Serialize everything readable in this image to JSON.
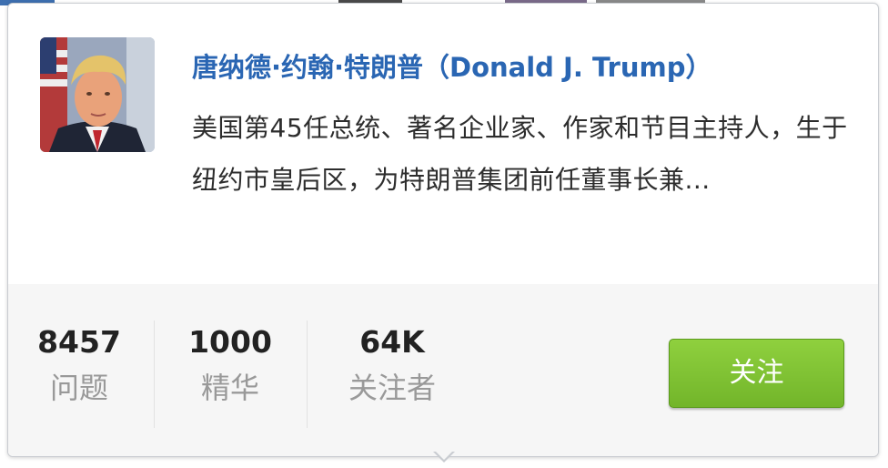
{
  "card": {
    "name": "唐纳德·约翰·特朗普（Donald J. Trump）",
    "bio": "美国第45任总统、著名企业家、作家和节目主持人，生于纽约市皇后区，为特朗普集团前任董事长兼..."
  },
  "stats": [
    {
      "value": "8457",
      "label": "问题"
    },
    {
      "value": "1000",
      "label": "精华"
    },
    {
      "value": "64K",
      "label": "关注者"
    }
  ],
  "follow_button": {
    "label": "关注"
  },
  "colors": {
    "name_link": "#2a66b3",
    "button_green": "#7cc032",
    "stats_bg": "#f6f6f6"
  },
  "icons": {
    "avatar": "profile-photo"
  }
}
